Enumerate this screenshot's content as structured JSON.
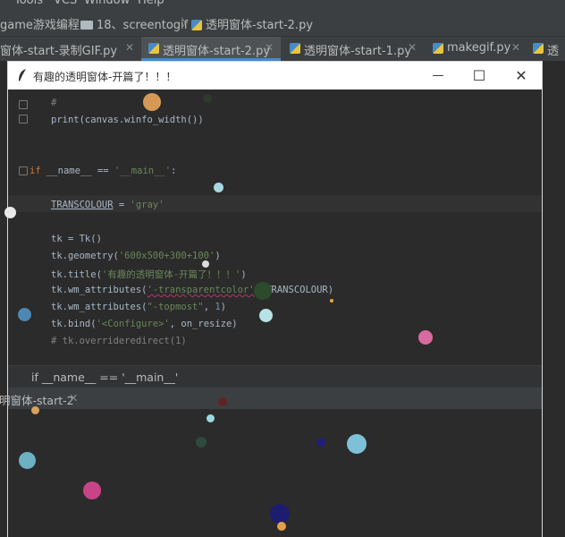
{
  "menubar": {
    "items": [
      "Tools",
      "VCS",
      "Window",
      "Help"
    ]
  },
  "navbar": {
    "crumbs": [
      "game游戏编程",
      "18、screentogif",
      "透明窗体-start-2.py"
    ]
  },
  "tabs": [
    {
      "label": "窗体-start-录制GIF.py",
      "active": false
    },
    {
      "label": "透明窗体-start-2.py",
      "active": true
    },
    {
      "label": "透明窗体-start-1.py",
      "active": false
    },
    {
      "label": "makegif.py",
      "active": false
    },
    {
      "label": "透",
      "active": false
    }
  ],
  "window": {
    "title": "有趣的透明窗体-开篇了！！！",
    "minimize": "—",
    "maximize": "☐",
    "close": "✕"
  },
  "code": {
    "l1_comment": "#",
    "l1_rest": ")",
    "l2_print": "print",
    "l2_rest": "(canvas.winfo_width())",
    "l3_if": "if",
    "l3_name": " __name__ == ",
    "l3_main": "'__main__'",
    "l3_colon": ":",
    "l4_var": "TRANSCOLOUR",
    "l4_eq": " = ",
    "l4_val": "'gray'",
    "l5": "tk = Tk()",
    "l6_a": "tk.geometry(",
    "l6_s": "'600x500+300+100'",
    "l6_b": ")",
    "l7_a": "tk.title(",
    "l7_s": "'有趣的透明窗体-开篇了！！！'",
    "l7_b": ")",
    "l8_a": "tk.wm_attributes(",
    "l8_s": "'-transparentcolor'",
    "l8_b": ", TRANSCOLOUR)",
    "l9_a": "tk.wm_attributes(",
    "l9_s": "\"-topmost\"",
    "l9_c": ", ",
    "l9_n": "1",
    "l9_b": ")",
    "l10_a": "tk.bind(",
    "l10_s": "'<Configure>'",
    "l10_b": ", on_resize)",
    "l11": "# tk.overrideredirect(1)"
  },
  "breadcrumb_bottom": "if __name__ == '__main__'",
  "run_tab": {
    "label": "明窗体-start-2",
    "close": "✕"
  },
  "balls": [
    {
      "color": "#e8a55a",
      "opacity": 0.9
    },
    {
      "color": "#2e3a2e",
      "opacity": 1
    },
    {
      "color": "#a8d8df",
      "opacity": 1
    },
    {
      "color": "#e9e9e9",
      "opacity": 1
    },
    {
      "color": "#2c4a2c",
      "opacity": 1
    },
    {
      "color": "#dcdcdc",
      "opacity": 1
    },
    {
      "color": "#b7e3e8",
      "opacity": 1
    },
    {
      "color": "#e8a64a",
      "opacity": 1
    },
    {
      "color": "#4e87b3",
      "opacity": 1
    },
    {
      "color": "#d96aa0",
      "opacity": 1
    },
    {
      "color": "#d9a35c",
      "opacity": 1
    },
    {
      "color": "#5e2424",
      "opacity": 1
    },
    {
      "color": "#9ad9e0",
      "opacity": 1
    },
    {
      "color": "#2d4a3d",
      "opacity": 1
    },
    {
      "color": "#1f1f7a",
      "opacity": 1
    },
    {
      "color": "#7fc0d9",
      "opacity": 1
    },
    {
      "color": "#6eb0c4",
      "opacity": 1
    },
    {
      "color": "#c94486",
      "opacity": 1
    },
    {
      "color": "#1e1c6e",
      "opacity": 1
    },
    {
      "color": "#e2a04a",
      "opacity": 1
    }
  ]
}
